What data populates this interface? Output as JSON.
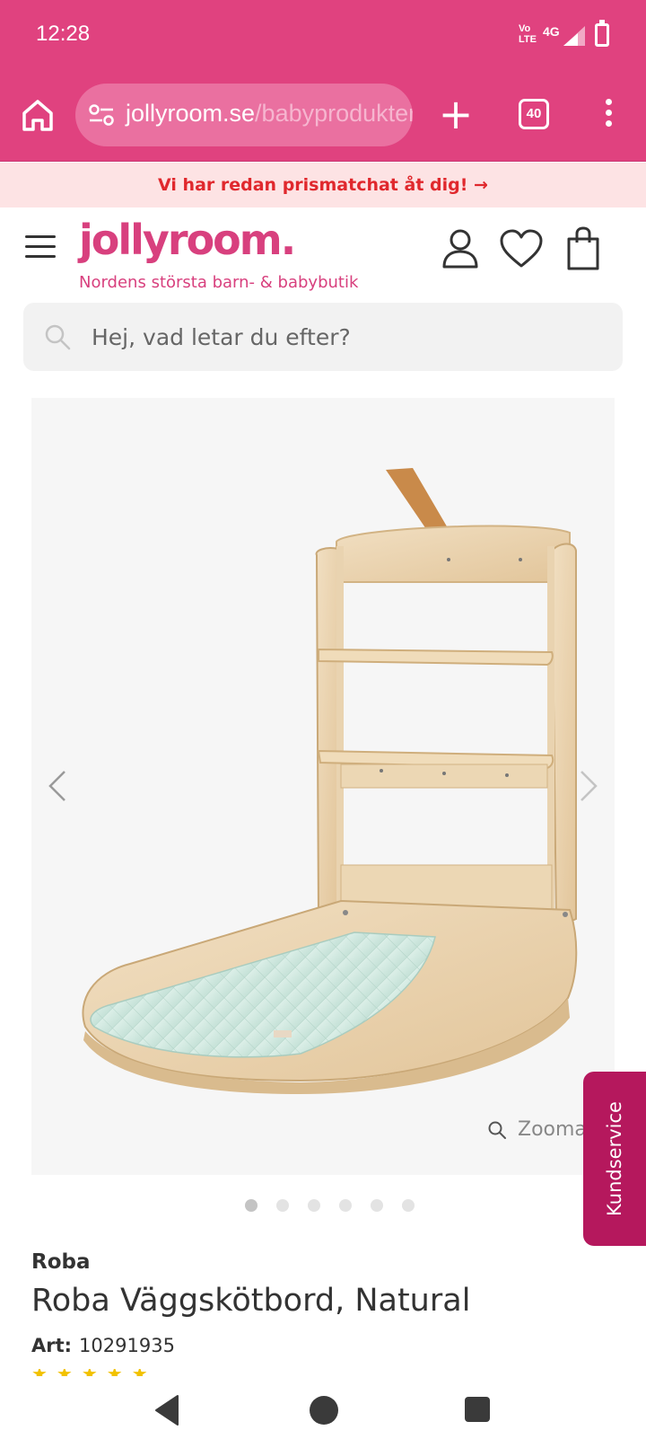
{
  "status_bar": {
    "time": "12:28",
    "network_top": "Vo",
    "network_bottom": "LTE",
    "network_type": "4G",
    "icons": [
      "signal-icon",
      "battery-icon"
    ]
  },
  "browser": {
    "url_host": "jollyroom.se",
    "url_path": "/babyprodukter",
    "tab_count": "40",
    "icons": [
      "home-icon",
      "site-settings-icon",
      "new-tab-icon",
      "tab-switcher-icon",
      "overflow-menu-icon"
    ],
    "toolbar_color": "#e0427f"
  },
  "promo": {
    "text": "Vi har redan prismatchat åt dig! →"
  },
  "header": {
    "logo": "jollyroom.",
    "tagline": "Nordens största barn- & babybutik",
    "brand_color": "#d8407e",
    "icons": [
      "hamburger-menu-icon",
      "account-icon",
      "heart-icon",
      "shopping-bag-icon"
    ]
  },
  "search": {
    "placeholder": "Hej, vad letar du efter?"
  },
  "gallery": {
    "image": "Roba wall changing table, natural wood with mint quilted mat",
    "zoom_label": "Zooma",
    "dots_count": 6,
    "active_dot": 0
  },
  "kundservice": {
    "label": "Kundservice",
    "color": "#b5185d"
  },
  "product": {
    "brand": "Roba",
    "title": "Roba Väggskötbord, Natural",
    "art_label": "Art:",
    "art_number": "10291935"
  },
  "nav_bar": {
    "icons": [
      "back-icon",
      "home-circle-icon",
      "recents-icon"
    ]
  }
}
